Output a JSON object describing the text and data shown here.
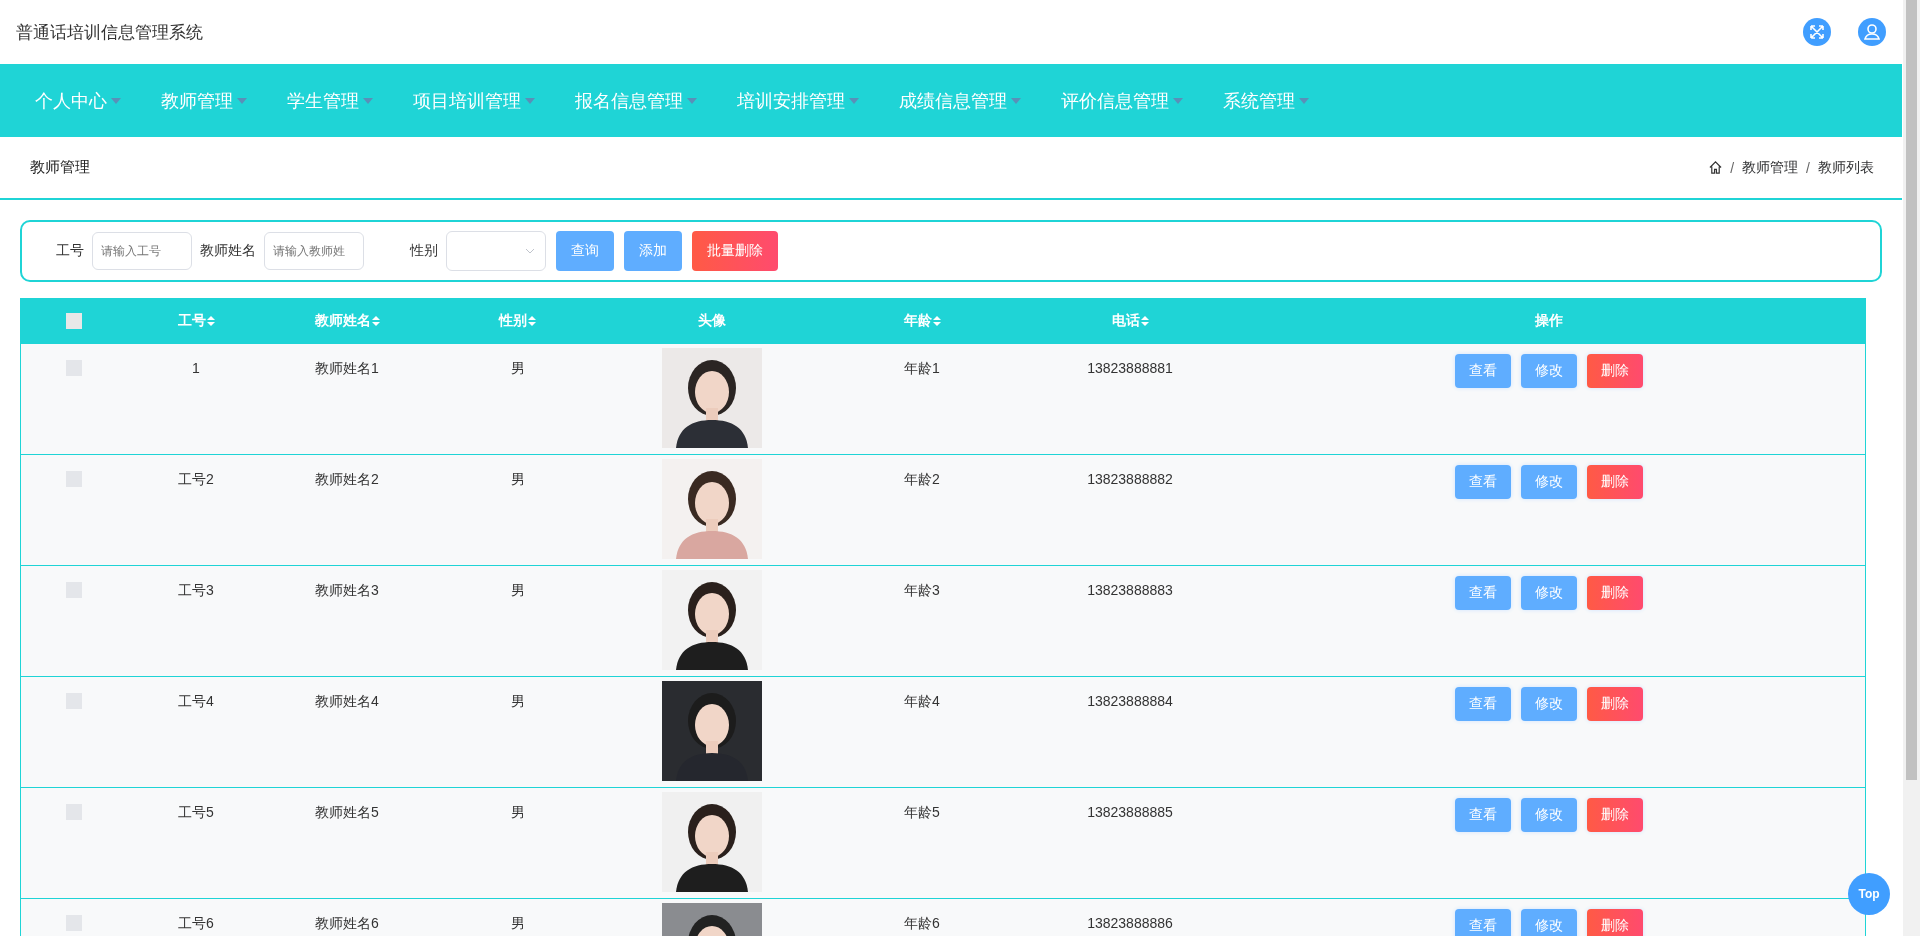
{
  "app_title": "普通话培训信息管理系统",
  "nav": [
    {
      "label": "个人中心"
    },
    {
      "label": "教师管理"
    },
    {
      "label": "学生管理"
    },
    {
      "label": "项目培训管理"
    },
    {
      "label": "报名信息管理"
    },
    {
      "label": "培训安排管理"
    },
    {
      "label": "成绩信息管理"
    },
    {
      "label": "评价信息管理"
    },
    {
      "label": "系统管理"
    }
  ],
  "page_title": "教师管理",
  "breadcrumb": [
    {
      "kind": "separator",
      "text": "/"
    },
    {
      "kind": "link",
      "text": "教师管理"
    },
    {
      "kind": "separator",
      "text": "/"
    },
    {
      "kind": "link",
      "text": "教师列表"
    }
  ],
  "search": {
    "fields": [
      {
        "label": "工号",
        "placeholder": "请输入工号",
        "kind": "input"
      },
      {
        "label": "教师姓名",
        "placeholder": "请输入教师姓",
        "kind": "input"
      },
      {
        "label": "性别",
        "kind": "select"
      }
    ],
    "buttons": [
      {
        "label": "查询",
        "kind": "primary"
      },
      {
        "label": "添加",
        "kind": "primary"
      },
      {
        "label": "批量删除",
        "kind": "danger"
      }
    ]
  },
  "table": {
    "select_all": {
      "checked": false
    },
    "columns": [
      {
        "label": "工号",
        "sortable": true
      },
      {
        "label": "教师姓名",
        "sortable": true
      },
      {
        "label": "性别",
        "sortable": true
      },
      {
        "label": "头像",
        "sortable": false
      },
      {
        "label": "年龄",
        "sortable": true
      },
      {
        "label": "电话",
        "sortable": true
      },
      {
        "label": "操作",
        "sortable": false
      }
    ],
    "rows": [
      {
        "checked": false,
        "id": "1",
        "name": "教师姓名1",
        "gender": "男",
        "age": "年龄1",
        "phone": "13823888881",
        "photo": {
          "kind": "picture"
        },
        "actions": [
          {
            "label": "查看",
            "kind": "primary"
          },
          {
            "label": "修改",
            "kind": "primary"
          },
          {
            "label": "删除",
            "kind": "danger"
          }
        ]
      },
      {
        "checked": false,
        "id": "工号2",
        "name": "教师姓名2",
        "gender": "男",
        "age": "年龄2",
        "phone": "13823888882",
        "photo": {
          "kind": "picture"
        },
        "actions": [
          {
            "label": "查看",
            "kind": "primary"
          },
          {
            "label": "修改",
            "kind": "primary"
          },
          {
            "label": "删除",
            "kind": "danger"
          }
        ]
      },
      {
        "checked": false,
        "id": "工号3",
        "name": "教师姓名3",
        "gender": "男",
        "age": "年龄3",
        "phone": "13823888883",
        "photo": {
          "kind": "picture"
        },
        "actions": [
          {
            "label": "查看",
            "kind": "primary"
          },
          {
            "label": "修改",
            "kind": "primary"
          },
          {
            "label": "删除",
            "kind": "danger"
          }
        ]
      },
      {
        "checked": false,
        "id": "工号4",
        "name": "教师姓名4",
        "gender": "男",
        "age": "年龄4",
        "phone": "13823888884",
        "photo": {
          "kind": "picture"
        },
        "actions": [
          {
            "label": "查看",
            "kind": "primary"
          },
          {
            "label": "修改",
            "kind": "primary"
          },
          {
            "label": "删除",
            "kind": "danger"
          }
        ]
      },
      {
        "checked": false,
        "id": "工号5",
        "name": "教师姓名5",
        "gender": "男",
        "age": "年龄5",
        "phone": "13823888885",
        "photo": {
          "kind": "picture"
        },
        "actions": [
          {
            "label": "查看",
            "kind": "primary"
          },
          {
            "label": "修改",
            "kind": "primary"
          },
          {
            "label": "删除",
            "kind": "danger"
          }
        ]
      },
      {
        "checked": false,
        "id": "工号6",
        "name": "教师姓名6",
        "gender": "男",
        "age": "年龄6",
        "phone": "13823888886",
        "photo": {
          "kind": "picture"
        },
        "actions": [
          {
            "label": "查看",
            "kind": "primary"
          },
          {
            "label": "修改",
            "kind": "primary"
          },
          {
            "label": "删除",
            "kind": "danger"
          }
        ]
      }
    ]
  },
  "back_to_top": "Top"
}
